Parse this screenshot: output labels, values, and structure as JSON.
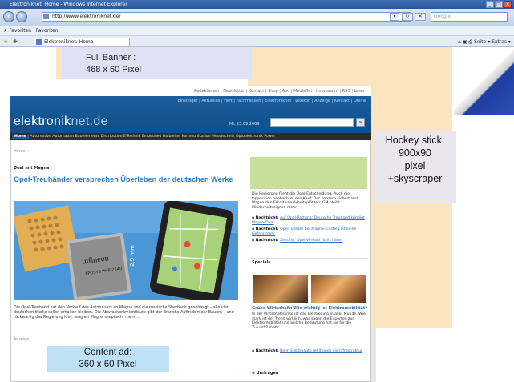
{
  "browser": {
    "title": "Elektroniknet: Home - Windows Internet Explorer",
    "url": "http://www.elektroniknet.de/",
    "search_placeholder": "Google",
    "favorites_bar": "Favoriten  ·  Favoriten",
    "tab_label": "Elektroniknet: Home",
    "tools_label": "Seite ▾  Extras ▾"
  },
  "ad_labels": {
    "full_banner_line1": "Full Banner :",
    "full_banner_line2": "468 x 60 Pixel",
    "hockey_line1": "Hockey stick:",
    "hockey_line2": "900x90",
    "hockey_line3": "pixel",
    "hockey_line4": "+skyscraper",
    "content_ad_line1": "Content ad:",
    "content_ad_line2": "360 x 60 Pixel"
  },
  "site": {
    "top_links": "Redaktionen | Newsletter | Kontakt | Shop | Abo | Mediaflat | Impressum | RSS | Leser",
    "sub_nav": "Einsteiger | Aktuelles | Heft | Fachmessen | Elektroniknet | Lexikon | Anzeige | Kontakt | Online",
    "logo_main": "elektronik",
    "logo_net": "net",
    "logo_dom": ".de",
    "date": "Mi, 23.09.2009",
    "search_button": "»",
    "menu_active": "Home",
    "menu_items": "Automotive  Automation  Bauelemente  Distribution  E-Technik  Embedded  Halbleiter  Kommunikation  Messtechnik  Optoelektronik  Power",
    "breadcrumb": "Home »",
    "kicker": "Deal mit Magna",
    "headline": "Opel-Treuhänder versprechen Überleben der deutschen Werke",
    "article_text": "Die Opel-Treuhand hat den Verkauf des Autobauers an Magna und die russische Sberbank genehmigt – alle vier deutschen Werke sollen erhalten bleiben. Die Abwrackprämienflaute gibt der Branche Auftrieb mehr Bauern – und rückwärtig das Regierung lobt, reagiert Magna skeptisch. mehr ...",
    "anzeige": "Anzeige",
    "side_intro": "Die Regierung flieht die Opel-Entscheidung. Auch die Opposition beobachtet den Kauf. Der Konzern sichert laut Magna den Erhalt von Arbeitsplätzen, GM bleibt Minderheitseigner. mehr",
    "side_news": [
      {
        "bold": "Nachtricht:",
        "text": "Auf Opel-Rettung: Deutsche Treuhand kündigt Magna-Deal"
      },
      {
        "bold": "Nachtricht:",
        "text": "Opel: Gefahr bei Magna-Einstieg ist keine Gefahr mehr"
      },
      {
        "bold": "Nachtricht:",
        "text": "Zeitung: Opel-Verkauf rückt näher"
      }
    ],
    "specials_heading": "Specials",
    "video_title": "Grüne Wirtschaft: Wie wichtig ist Elektromobilität?",
    "video_text": "In der Wirtschaftskrise ist das Elektroauto in aller Munde. Wie stark ist der Trend wirklich, was sagen die Experten zur Elektromobilität und welche Bedeutung hat sie für die Zukunft? mehr",
    "side_link2_bold": "Nachtricht:",
    "side_link2_text": "Beim Elektroauto fehlt noch die Infrastruktur",
    "downloads_heading": "Umfragen"
  },
  "colors": {
    "peach": "#fbe5c0",
    "full_banner": "#dfe1f4",
    "content_ad": "#bfe1f5",
    "hockey_label": "#e9e6ee",
    "site_header": "#1a5f9e",
    "green_ad": "#c6df9c",
    "headline": "#2f7ac5"
  }
}
